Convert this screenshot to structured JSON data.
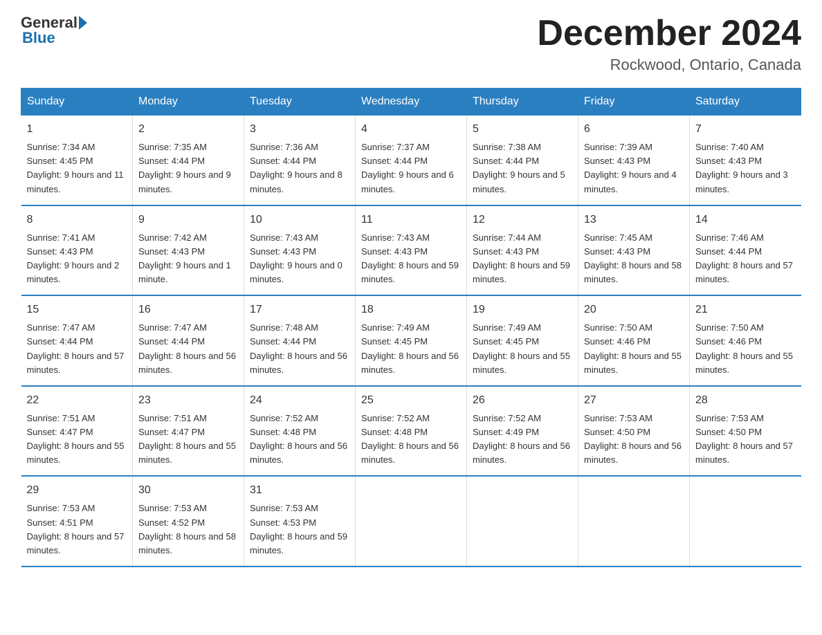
{
  "logo": {
    "general": "General",
    "blue": "Blue"
  },
  "title": "December 2024",
  "location": "Rockwood, Ontario, Canada",
  "days_header": [
    "Sunday",
    "Monday",
    "Tuesday",
    "Wednesday",
    "Thursday",
    "Friday",
    "Saturday"
  ],
  "weeks": [
    [
      {
        "day": "1",
        "sunrise": "7:34 AM",
        "sunset": "4:45 PM",
        "daylight": "9 hours and 11 minutes."
      },
      {
        "day": "2",
        "sunrise": "7:35 AM",
        "sunset": "4:44 PM",
        "daylight": "9 hours and 9 minutes."
      },
      {
        "day": "3",
        "sunrise": "7:36 AM",
        "sunset": "4:44 PM",
        "daylight": "9 hours and 8 minutes."
      },
      {
        "day": "4",
        "sunrise": "7:37 AM",
        "sunset": "4:44 PM",
        "daylight": "9 hours and 6 minutes."
      },
      {
        "day": "5",
        "sunrise": "7:38 AM",
        "sunset": "4:44 PM",
        "daylight": "9 hours and 5 minutes."
      },
      {
        "day": "6",
        "sunrise": "7:39 AM",
        "sunset": "4:43 PM",
        "daylight": "9 hours and 4 minutes."
      },
      {
        "day": "7",
        "sunrise": "7:40 AM",
        "sunset": "4:43 PM",
        "daylight": "9 hours and 3 minutes."
      }
    ],
    [
      {
        "day": "8",
        "sunrise": "7:41 AM",
        "sunset": "4:43 PM",
        "daylight": "9 hours and 2 minutes."
      },
      {
        "day": "9",
        "sunrise": "7:42 AM",
        "sunset": "4:43 PM",
        "daylight": "9 hours and 1 minute."
      },
      {
        "day": "10",
        "sunrise": "7:43 AM",
        "sunset": "4:43 PM",
        "daylight": "9 hours and 0 minutes."
      },
      {
        "day": "11",
        "sunrise": "7:43 AM",
        "sunset": "4:43 PM",
        "daylight": "8 hours and 59 minutes."
      },
      {
        "day": "12",
        "sunrise": "7:44 AM",
        "sunset": "4:43 PM",
        "daylight": "8 hours and 59 minutes."
      },
      {
        "day": "13",
        "sunrise": "7:45 AM",
        "sunset": "4:43 PM",
        "daylight": "8 hours and 58 minutes."
      },
      {
        "day": "14",
        "sunrise": "7:46 AM",
        "sunset": "4:44 PM",
        "daylight": "8 hours and 57 minutes."
      }
    ],
    [
      {
        "day": "15",
        "sunrise": "7:47 AM",
        "sunset": "4:44 PM",
        "daylight": "8 hours and 57 minutes."
      },
      {
        "day": "16",
        "sunrise": "7:47 AM",
        "sunset": "4:44 PM",
        "daylight": "8 hours and 56 minutes."
      },
      {
        "day": "17",
        "sunrise": "7:48 AM",
        "sunset": "4:44 PM",
        "daylight": "8 hours and 56 minutes."
      },
      {
        "day": "18",
        "sunrise": "7:49 AM",
        "sunset": "4:45 PM",
        "daylight": "8 hours and 56 minutes."
      },
      {
        "day": "19",
        "sunrise": "7:49 AM",
        "sunset": "4:45 PM",
        "daylight": "8 hours and 55 minutes."
      },
      {
        "day": "20",
        "sunrise": "7:50 AM",
        "sunset": "4:46 PM",
        "daylight": "8 hours and 55 minutes."
      },
      {
        "day": "21",
        "sunrise": "7:50 AM",
        "sunset": "4:46 PM",
        "daylight": "8 hours and 55 minutes."
      }
    ],
    [
      {
        "day": "22",
        "sunrise": "7:51 AM",
        "sunset": "4:47 PM",
        "daylight": "8 hours and 55 minutes."
      },
      {
        "day": "23",
        "sunrise": "7:51 AM",
        "sunset": "4:47 PM",
        "daylight": "8 hours and 55 minutes."
      },
      {
        "day": "24",
        "sunrise": "7:52 AM",
        "sunset": "4:48 PM",
        "daylight": "8 hours and 56 minutes."
      },
      {
        "day": "25",
        "sunrise": "7:52 AM",
        "sunset": "4:48 PM",
        "daylight": "8 hours and 56 minutes."
      },
      {
        "day": "26",
        "sunrise": "7:52 AM",
        "sunset": "4:49 PM",
        "daylight": "8 hours and 56 minutes."
      },
      {
        "day": "27",
        "sunrise": "7:53 AM",
        "sunset": "4:50 PM",
        "daylight": "8 hours and 56 minutes."
      },
      {
        "day": "28",
        "sunrise": "7:53 AM",
        "sunset": "4:50 PM",
        "daylight": "8 hours and 57 minutes."
      }
    ],
    [
      {
        "day": "29",
        "sunrise": "7:53 AM",
        "sunset": "4:51 PM",
        "daylight": "8 hours and 57 minutes."
      },
      {
        "day": "30",
        "sunrise": "7:53 AM",
        "sunset": "4:52 PM",
        "daylight": "8 hours and 58 minutes."
      },
      {
        "day": "31",
        "sunrise": "7:53 AM",
        "sunset": "4:53 PM",
        "daylight": "8 hours and 59 minutes."
      },
      {
        "day": "",
        "sunrise": "",
        "sunset": "",
        "daylight": ""
      },
      {
        "day": "",
        "sunrise": "",
        "sunset": "",
        "daylight": ""
      },
      {
        "day": "",
        "sunrise": "",
        "sunset": "",
        "daylight": ""
      },
      {
        "day": "",
        "sunrise": "",
        "sunset": "",
        "daylight": ""
      }
    ]
  ]
}
